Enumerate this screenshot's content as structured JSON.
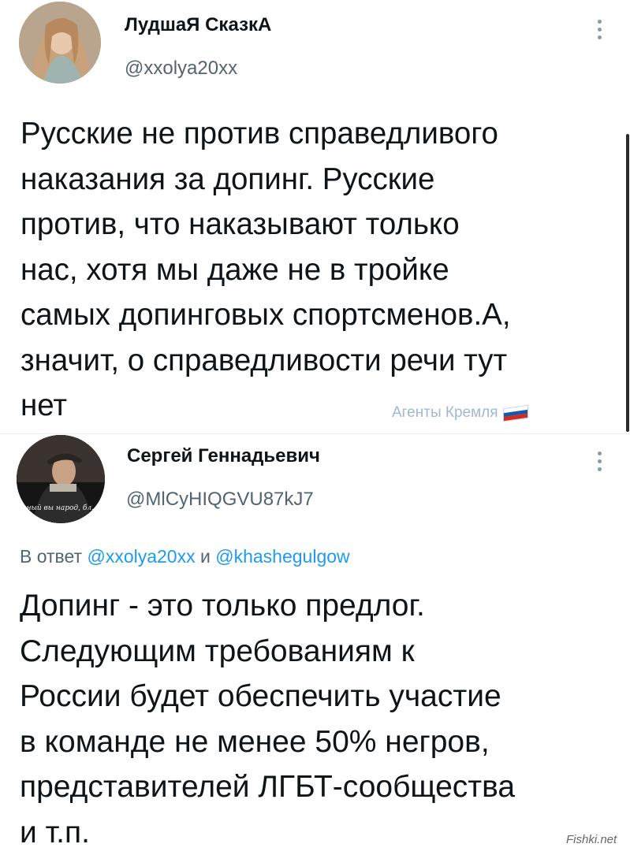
{
  "tweet1": {
    "display_name": "ЛудшаЯ СказкА",
    "handle": "@xxolya20xx",
    "text": "Русские не против справедливого\nнаказания за допинг. Русские\nпротив, что наказывают только\nнас,  хотя мы даже не в тройке\nсамых допинговых спортсменов.А,\nзначит, о справедливости речи тут\nнет"
  },
  "watermark_agents": "Агенты Кремля",
  "tweet2": {
    "display_name": "Сергей Геннадьевич",
    "handle": "@MlCyHIQGVU87kJ7",
    "avatar_caption": "...ный вы народ, бл...",
    "reply_prefix": "В ответ",
    "reply_user1": "@xxolya20xx",
    "reply_and": "и",
    "reply_user2": "@khashegulgow",
    "text": "Допинг - это только предлог.\nСледующим требованиям к\nРоссии будет обеспечить участие\nв команде не менее 50% негров,\nпредставителей ЛГБТ-сообщества\nи т.п."
  },
  "watermark_site": "Fishki.net",
  "colors": {
    "text": "#0f1419",
    "secondary": "#536471",
    "link": "#1d9bf0",
    "divider": "#e6ecf0"
  }
}
